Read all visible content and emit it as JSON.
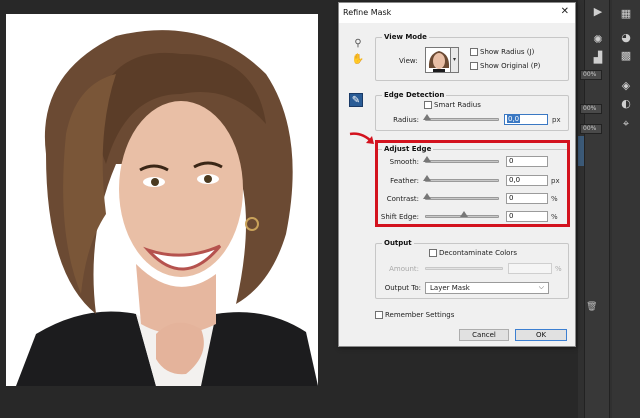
{
  "dialog": {
    "title": "Refine Mask",
    "close_glyph": "✕"
  },
  "view_mode": {
    "title": "View Mode",
    "view_label": "View:",
    "show_radius": "Show Radius (J)",
    "show_original": "Show Original (P)"
  },
  "edge_detection": {
    "title": "Edge Detection",
    "smart_radius": "Smart Radius",
    "radius_label": "Radius:",
    "radius_value": "0,0",
    "radius_unit": "px"
  },
  "adjust_edge": {
    "title": "Adjust Edge",
    "smooth_label": "Smooth:",
    "smooth_value": "0",
    "feather_label": "Feather:",
    "feather_value": "0,0",
    "feather_unit": "px",
    "contrast_label": "Contrast:",
    "contrast_value": "0",
    "contrast_unit": "%",
    "shift_label": "Shift Edge:",
    "shift_value": "0",
    "shift_unit": "%"
  },
  "output": {
    "title": "Output",
    "decontaminate": "Decontaminate Colors",
    "amount_label": "Amount:",
    "amount_unit": "%",
    "output_to_label": "Output To:",
    "output_to_value": "Layer Mask"
  },
  "remember_settings": "Remember Settings",
  "buttons": {
    "cancel": "Cancel",
    "ok": "OK"
  },
  "panel": {
    "chip1": "00%",
    "chip2": "00%",
    "chip3": "00%"
  },
  "colors": {
    "annotation": "#d3121e",
    "accent": "#3a78c3"
  }
}
